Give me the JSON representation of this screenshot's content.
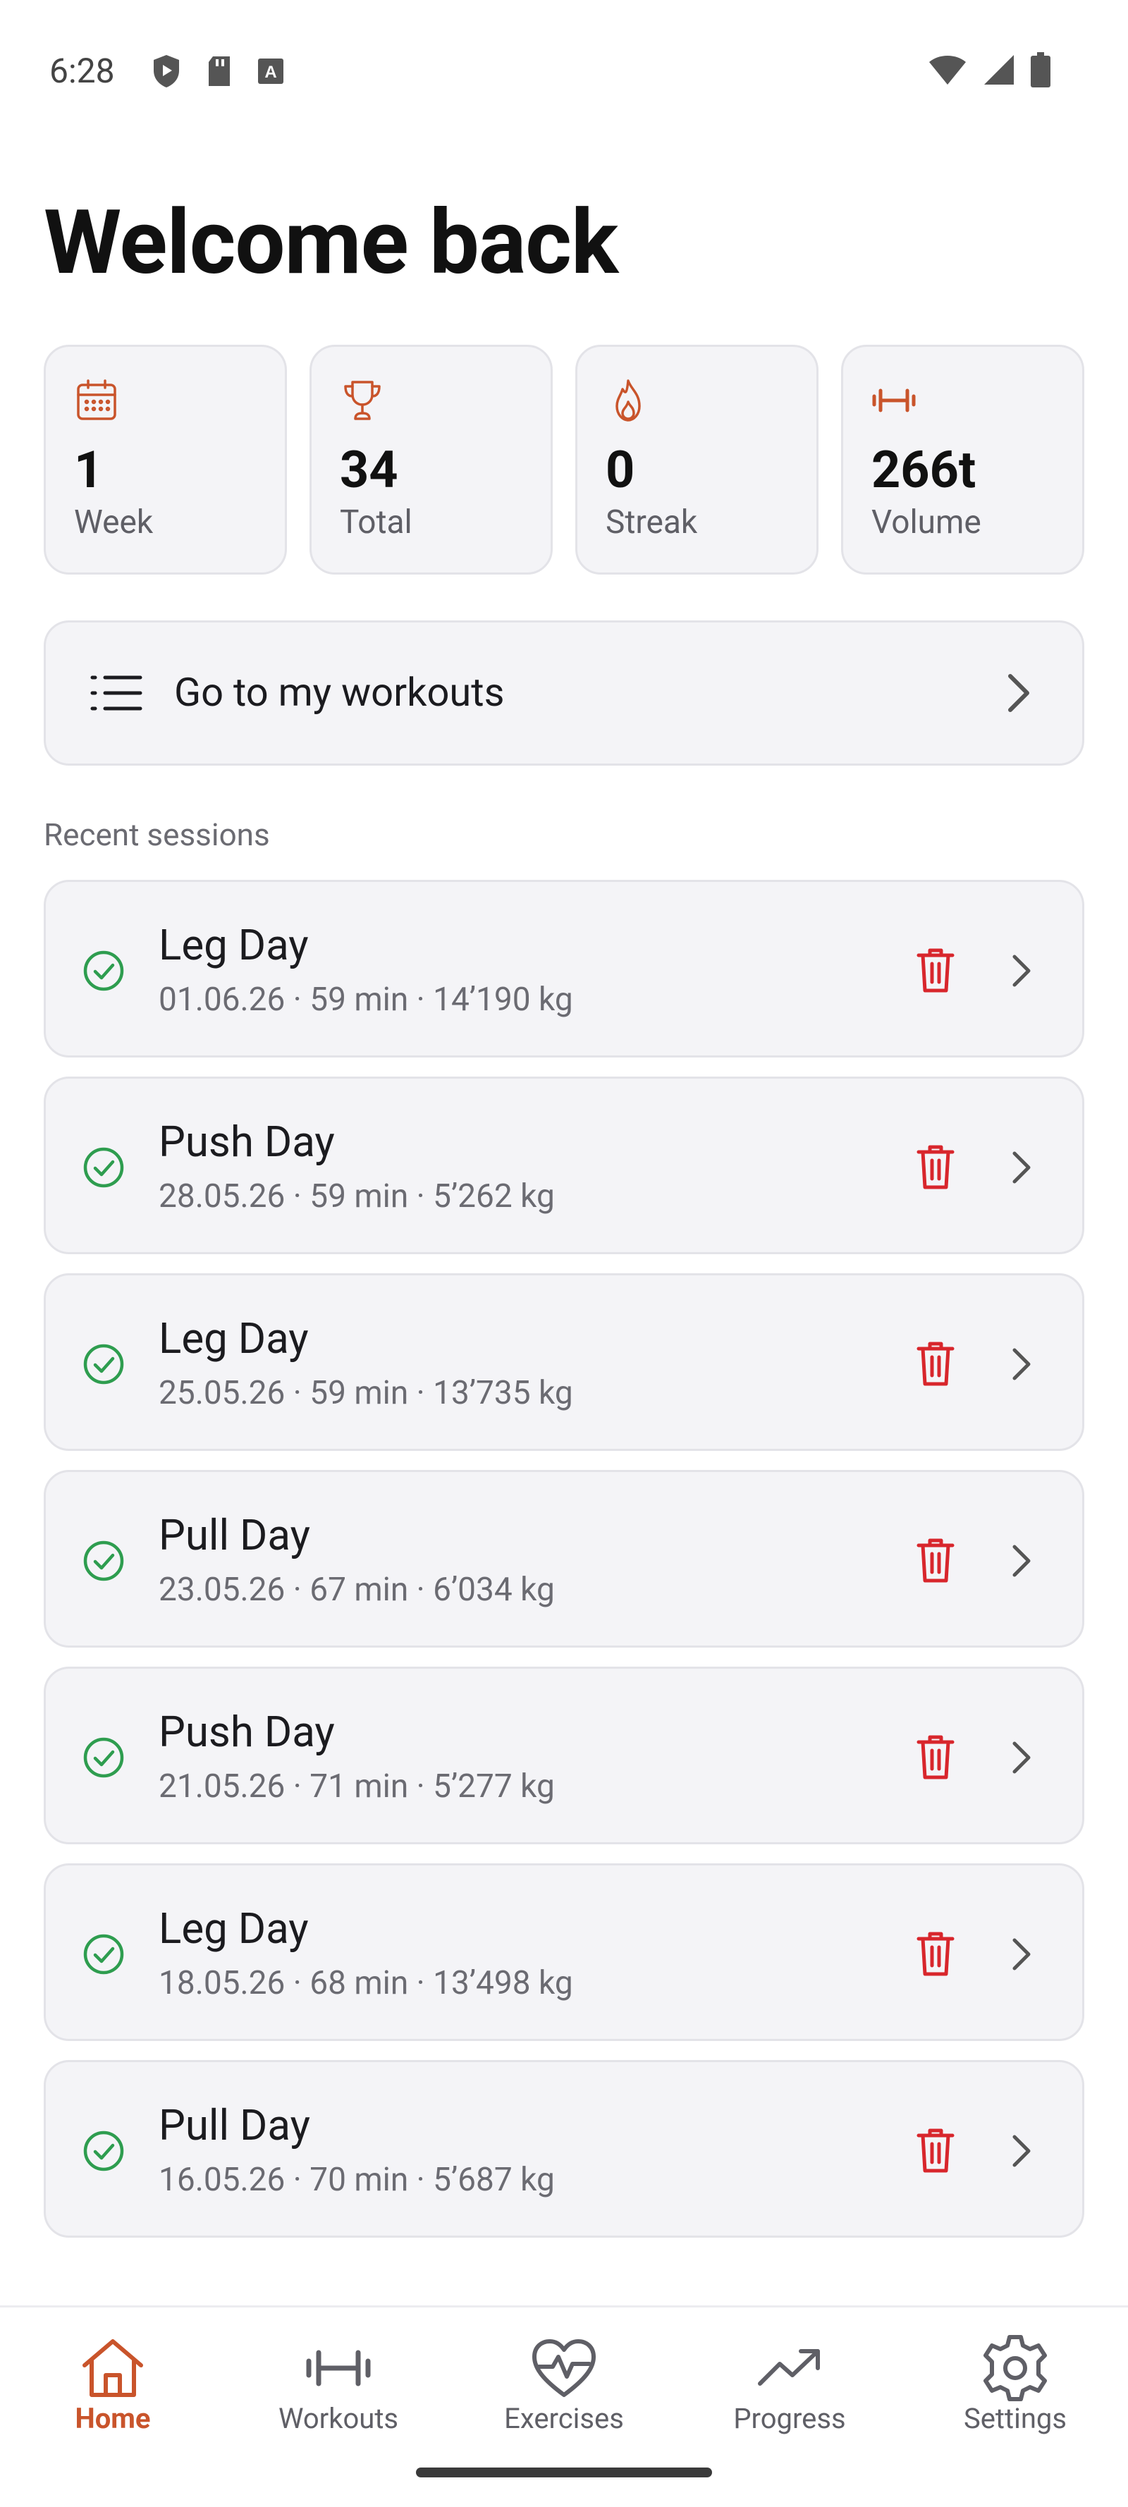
{
  "status_bar": {
    "time": "6:28",
    "icons_left": [
      "shield-icon",
      "sd-card-icon",
      "keyboard-a-icon"
    ],
    "icons_right": [
      "wifi-icon",
      "cell-signal-icon",
      "battery-icon"
    ]
  },
  "header": {
    "title": "Welcome back"
  },
  "accent_color": "#c9542b",
  "stats": [
    {
      "icon": "calendar-icon",
      "value": "1",
      "label": "Week"
    },
    {
      "icon": "trophy-icon",
      "value": "34",
      "label": "Total"
    },
    {
      "icon": "flame-icon",
      "value": "0",
      "label": "Streak"
    },
    {
      "icon": "dumbbell-icon",
      "value": "266t",
      "label": "Volume"
    }
  ],
  "goto_workouts": {
    "label": "Go to my workouts",
    "icon": "list-icon"
  },
  "recent": {
    "title": "Recent sessions",
    "sessions": [
      {
        "name": "Leg Day",
        "meta": "01.06.26 · 59 min · 14’190 kg"
      },
      {
        "name": "Push Day",
        "meta": "28.05.26 · 59 min · 5’262 kg"
      },
      {
        "name": "Leg Day",
        "meta": "25.05.26 · 59 min · 13’735 kg"
      },
      {
        "name": "Pull Day",
        "meta": "23.05.26 · 67 min · 6’034 kg"
      },
      {
        "name": "Push Day",
        "meta": "21.05.26 · 71 min · 5’277 kg"
      },
      {
        "name": "Leg Day",
        "meta": "18.05.26 · 68 min · 13’498 kg"
      },
      {
        "name": "Pull Day",
        "meta": "16.05.26 · 70 min · 5’687 kg"
      }
    ]
  },
  "bottom_nav": {
    "items": [
      {
        "label": "Home",
        "icon": "home-icon",
        "active": true
      },
      {
        "label": "Workouts",
        "icon": "dumbbell-icon",
        "active": false
      },
      {
        "label": "Exercises",
        "icon": "heart-pulse-icon",
        "active": false
      },
      {
        "label": "Progress",
        "icon": "trending-up-icon",
        "active": false
      },
      {
        "label": "Settings",
        "icon": "gear-icon",
        "active": false
      }
    ]
  }
}
